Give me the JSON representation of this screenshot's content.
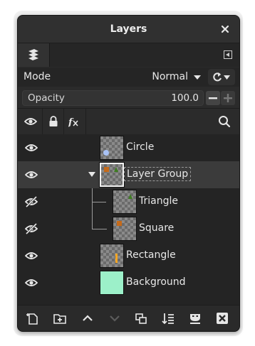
{
  "window": {
    "title": "Layers"
  },
  "controls": {
    "mode_label": "Mode",
    "mode_value": "Normal",
    "opacity_label": "Opacity",
    "opacity_value": "100.0"
  },
  "layers": [
    {
      "name": "Circle",
      "visible": true
    },
    {
      "name": "Layer Group",
      "visible": true,
      "selected": true,
      "expanded": true
    },
    {
      "name": "Triangle",
      "visible": false,
      "parent": "Layer Group"
    },
    {
      "name": "Square",
      "visible": false,
      "parent": "Layer Group"
    },
    {
      "name": "Rectangle",
      "visible": true
    },
    {
      "name": "Background",
      "visible": true,
      "fill": "#9cf0c9"
    }
  ],
  "colors": {
    "panel_bg": "#2b2b2b",
    "list_bg": "#242424",
    "selected_row": "#3b3b3b",
    "circle": "#a9c2f5",
    "triangle": "#3f7d22",
    "square": "#c56a1a",
    "rectangle": "#f5a623",
    "background_fill": "#9cf0c9"
  }
}
